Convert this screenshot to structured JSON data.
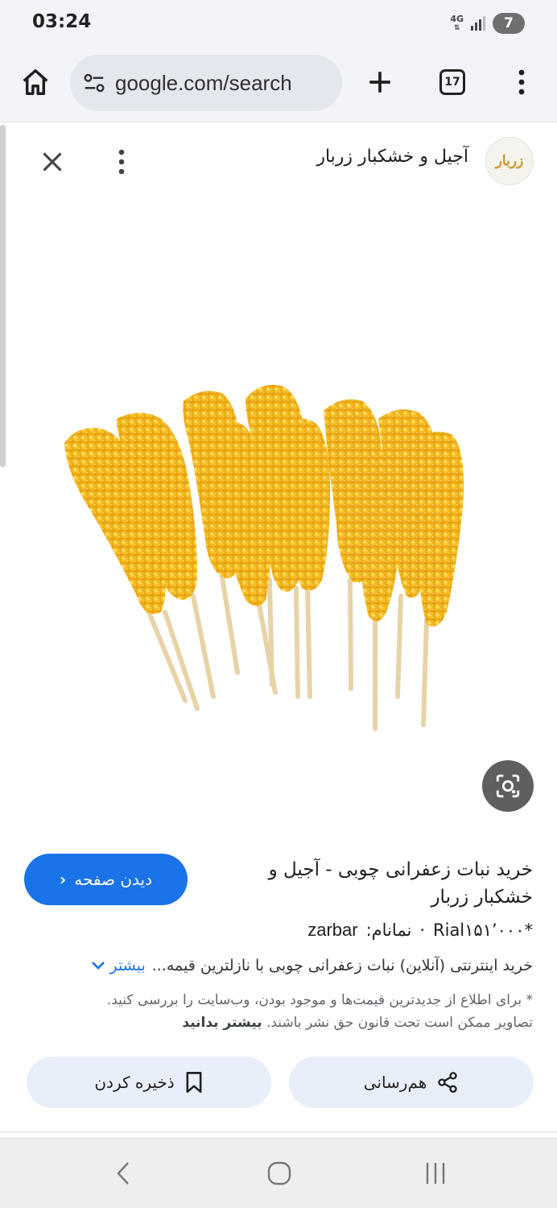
{
  "status_bar": {
    "time": "03:24",
    "network": "4G",
    "battery": "7"
  },
  "browser": {
    "url": "google.com/search",
    "tab_count": "17"
  },
  "viewer": {
    "source_name": "آجیل و خشکبار زربار",
    "source_logo_text": "زربار"
  },
  "result": {
    "visit_label": "دیدن صفحه",
    "title": "خرید نبات زعفرانی چوبی - آجیل و خشکبار زربار",
    "price": "*Rial۱۵۱٬۰۰۰",
    "separator": "·",
    "site_prefix": "نمانام:",
    "domain": "zarbar",
    "description": "خرید اینترنتی (آنلاین) نبات زعفرانی چوبی با نازلترین قیمه...",
    "more_label": "بیشتر",
    "disclaimer_text": "* برای اطلاع از جدیدترین قیمت‌ها و موجود بودن، وب‌سایت را بررسی کنید. تصاویر ممکن است تحت قانون حق نشر باشند.",
    "learn_more": "بیشتر بدانید"
  },
  "actions": {
    "share_label": "هم‌رسانی",
    "save_label": "ذخیره کردن"
  },
  "colors": {
    "accent": "#1a73e8",
    "action_bg": "#e9effa",
    "candy": "#f2b51c"
  }
}
